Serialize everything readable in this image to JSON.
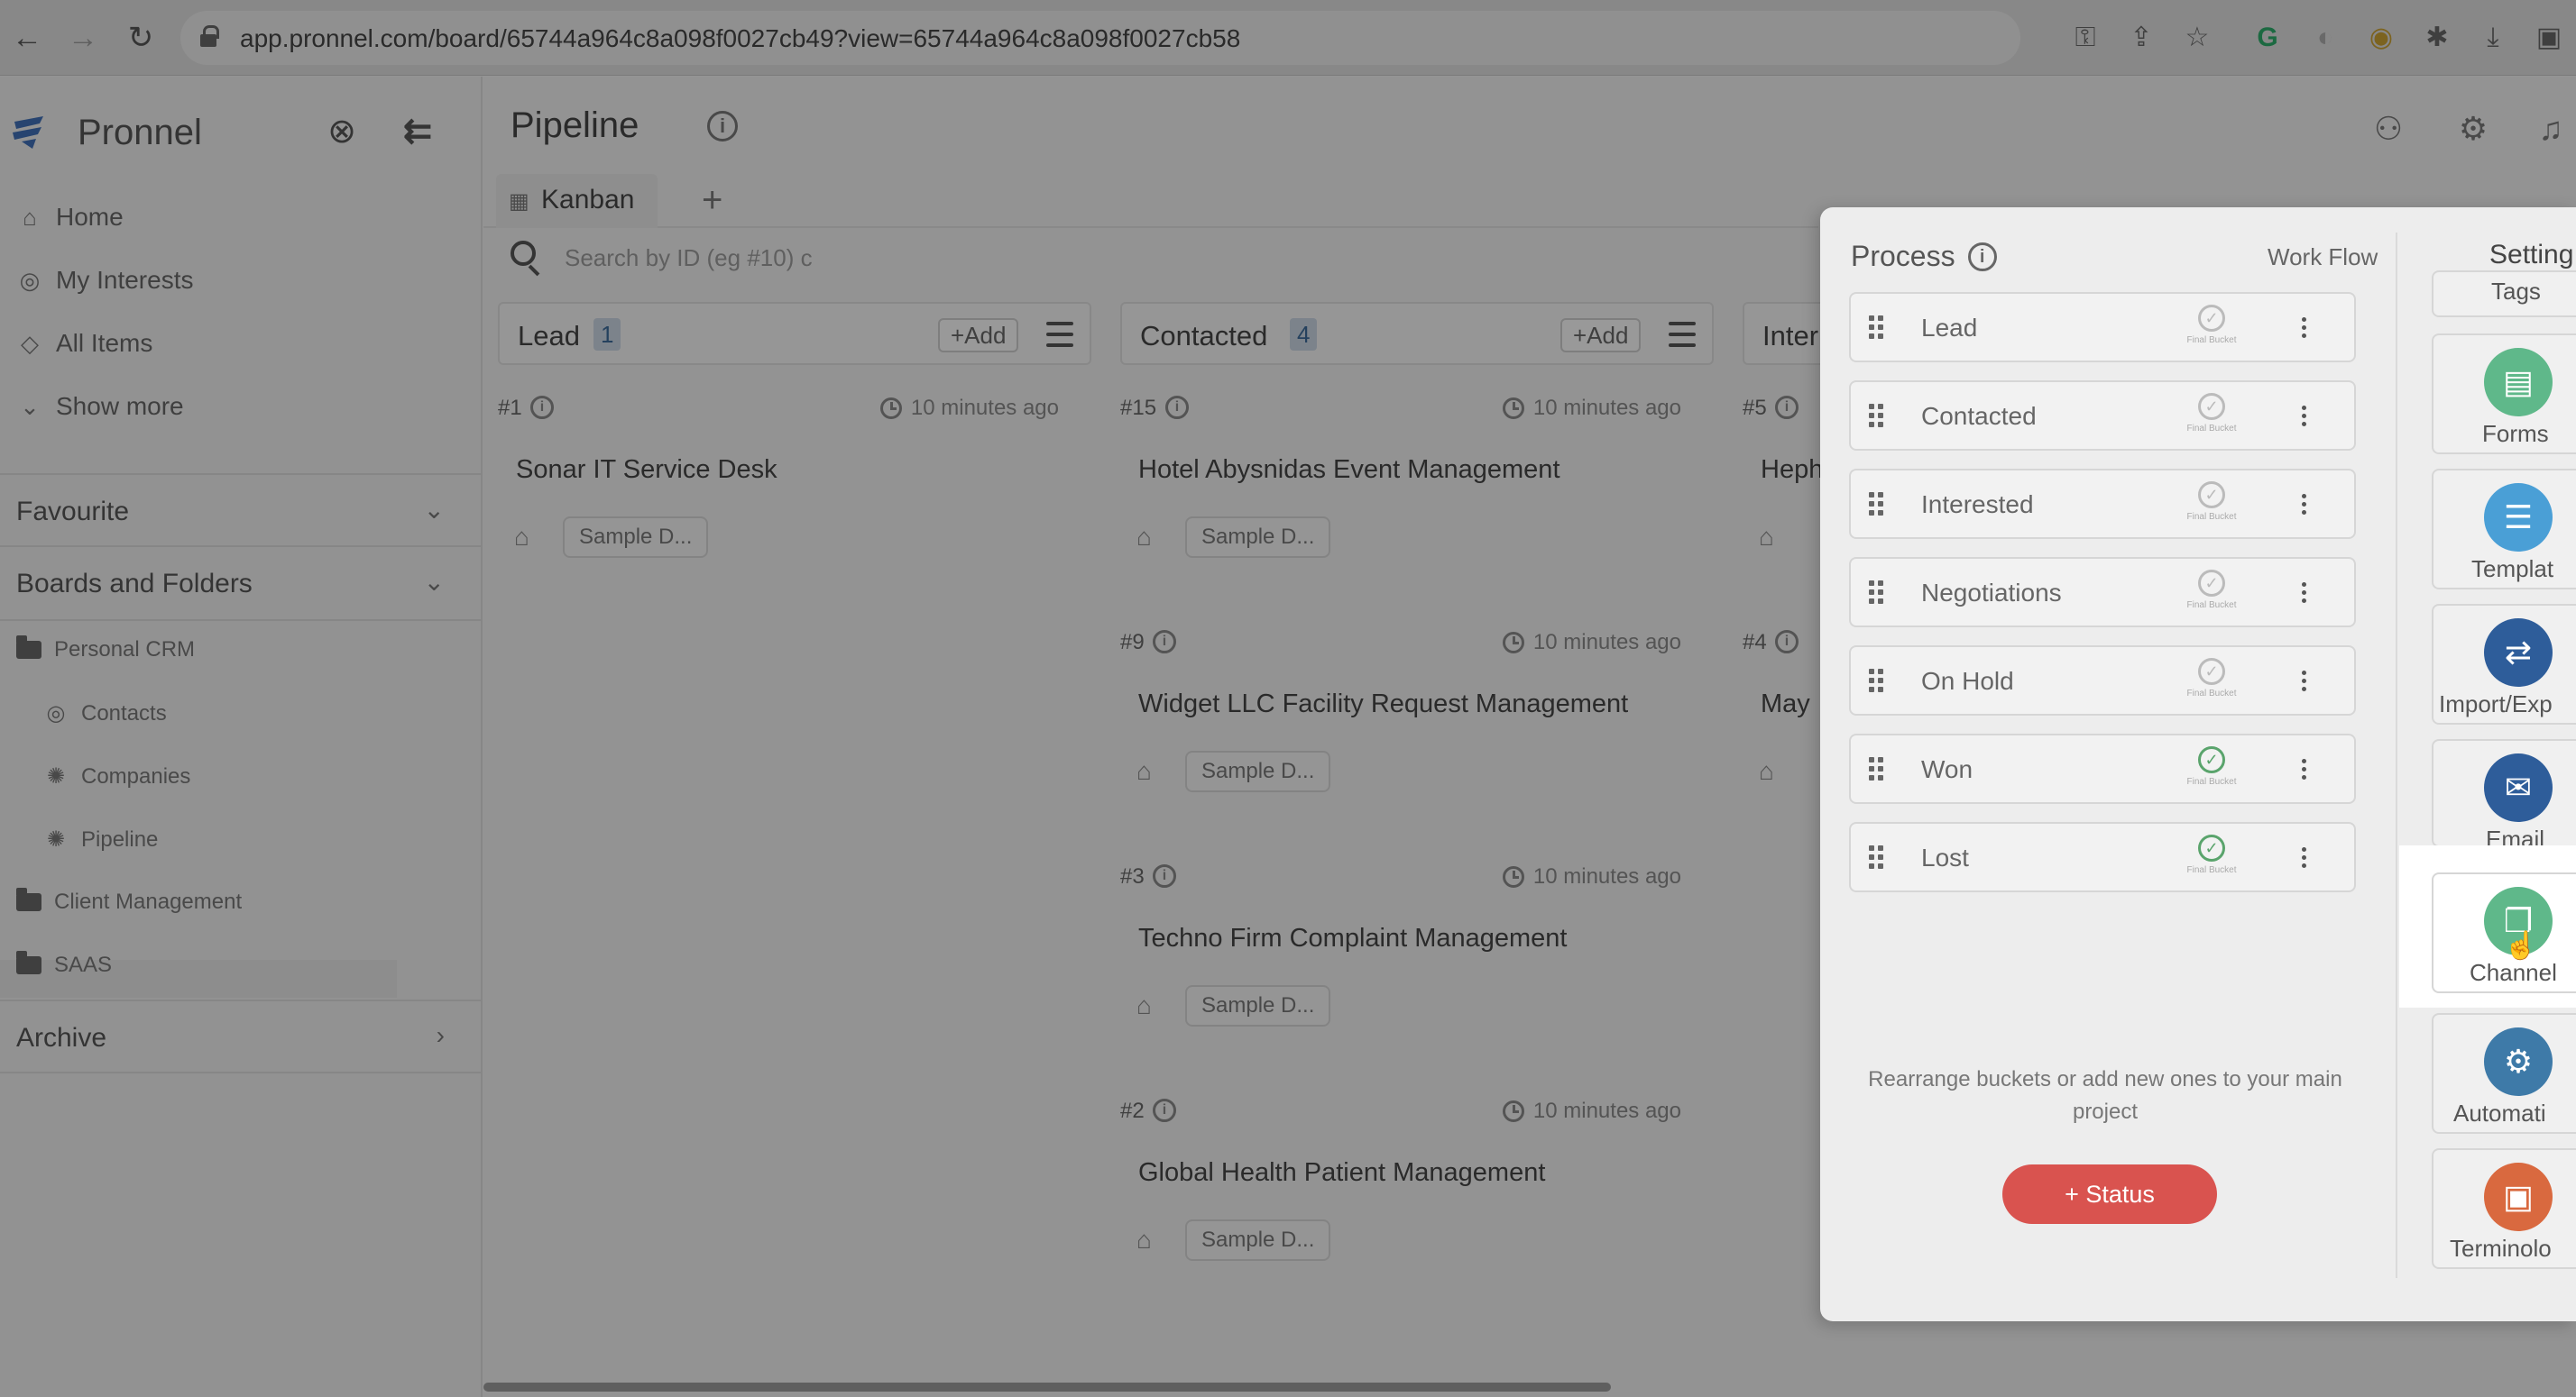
{
  "browser": {
    "url": "app.pronnel.com/board/65744a964c8a098f0027cb49?view=65744a964c8a098f0027cb58",
    "back_icon": "←",
    "forward_icon": "→",
    "reload_icon": "↻"
  },
  "sidebar": {
    "brand": "Pronnel",
    "nav": [
      {
        "label": "Home",
        "icon": "home-icon"
      },
      {
        "label": "My Interests",
        "icon": "target-icon"
      },
      {
        "label": "All Items",
        "icon": "diamond-icon"
      },
      {
        "label": "Show more",
        "icon": "chevron-down-icon"
      }
    ],
    "favourite": "Favourite",
    "boards_and_folders": "Boards and Folders",
    "folders": {
      "personal_crm": "Personal CRM",
      "contacts": "Contacts",
      "companies": "Companies",
      "pipeline": "Pipeline",
      "client_management": "Client Management",
      "saas": "SAAS"
    },
    "archive": "Archive"
  },
  "main": {
    "title": "Pipeline",
    "tab": "Kanban",
    "search_placeholder": "Search by ID (eg #10) c",
    "columns": [
      {
        "name": "Lead",
        "count": "1",
        "add": "+Add",
        "cards": [
          {
            "id": "#1",
            "time": "10 minutes ago",
            "title": "Sonar IT Service Desk",
            "tag": "Sample D..."
          }
        ]
      },
      {
        "name": "Contacted",
        "count": "4",
        "add": "+Add",
        "cards": [
          {
            "id": "#15",
            "time": "10 minutes ago",
            "title": "Hotel Abysnidas Event Management",
            "tag": "Sample D..."
          },
          {
            "id": "#9",
            "time": "10 minutes ago",
            "title": "Widget LLC Facility Request Management",
            "tag": "Sample D..."
          },
          {
            "id": "#3",
            "time": "10 minutes ago",
            "title": "Techno Firm Complaint Management",
            "tag": "Sample D..."
          },
          {
            "id": "#2",
            "time": "10 minutes ago",
            "title": "Global Health Patient Management",
            "tag": "Sample D..."
          }
        ]
      },
      {
        "name": "Inter",
        "cards": [
          {
            "id": "#5",
            "title": "Heph"
          },
          {
            "id": "#4",
            "title": "May"
          }
        ]
      }
    ]
  },
  "process": {
    "title": "Process",
    "workflow": "Work Flow",
    "final_bucket_label": "Final Bucket",
    "buckets": [
      {
        "name": "Lead",
        "final": false
      },
      {
        "name": "Contacted",
        "final": false
      },
      {
        "name": "Interested",
        "final": false
      },
      {
        "name": "Negotiations",
        "final": false
      },
      {
        "name": "On Hold",
        "final": false
      },
      {
        "name": "Won",
        "final": true
      },
      {
        "name": "Lost",
        "final": true
      }
    ],
    "hint": "Rearrange buckets or add new ones to your main project",
    "status_button": "+ Status"
  },
  "settings": {
    "title": "Setting",
    "tools": [
      {
        "label": "Tags",
        "icon": "tag-icon",
        "color": "#6f6f6f"
      },
      {
        "label": "Forms",
        "icon": "form-icon",
        "color": "#5fb88a"
      },
      {
        "label": "Templat",
        "icon": "template-icon",
        "color": "#4a9fd6"
      },
      {
        "label": "Import/Exp",
        "icon": "import-export-icon",
        "color": "#2e5d9a"
      },
      {
        "label": "Email",
        "icon": "email-icon",
        "color": "#2e5d9a"
      },
      {
        "label": "Channel",
        "icon": "chat-icon",
        "color": "#5fb88a"
      },
      {
        "label": "Automati",
        "icon": "automation-icon",
        "color": "#3e7aa8"
      },
      {
        "label": "Terminolo",
        "icon": "terminology-icon",
        "color": "#d9693f"
      }
    ]
  },
  "colors": {
    "accent": "#d9534f",
    "count_badge": "#3d6a98"
  }
}
